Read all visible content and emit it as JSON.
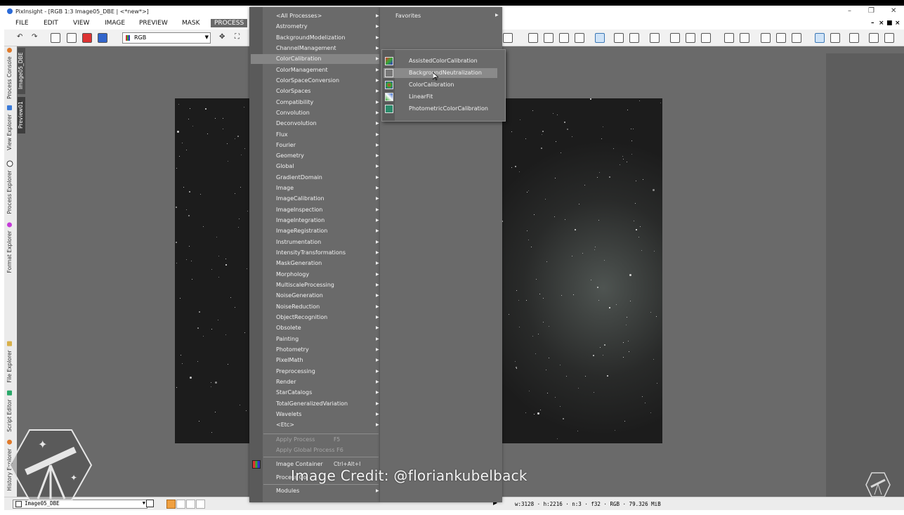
{
  "window": {
    "title": "PixInsight - [RGB 1:3 Image05_DBE | <*new*>]",
    "min": "–",
    "restore": "❐",
    "close": "✕"
  },
  "menubar": {
    "items": [
      "FILE",
      "EDIT",
      "VIEW",
      "IMAGE",
      "PREVIEW",
      "MASK",
      "PROCESS"
    ],
    "active": "PROCESS",
    "mdi_controls": [
      "–",
      "×",
      "■",
      "×"
    ]
  },
  "toolbar": {
    "channel_combo": "RGB"
  },
  "sidebar": {
    "top_tabs": [
      "Process Console",
      "View Explorer",
      "Process Explorer",
      "Format Explorer"
    ],
    "bottom_tabs": [
      "File Explorer",
      "Script Editor",
      "History Explorer"
    ],
    "view_tabs": [
      "Image05_DBE",
      "Preview01"
    ]
  },
  "process_menu": {
    "items": [
      "<All Processes>",
      "Astrometry",
      "BackgroundModelization",
      "ChannelManagement",
      "ColorCalibration",
      "ColorManagement",
      "ColorSpaceConversion",
      "ColorSpaces",
      "Compatibility",
      "Convolution",
      "Deconvolution",
      "Flux",
      "Fourier",
      "Geometry",
      "Global",
      "GradientDomain",
      "Image",
      "ImageCalibration",
      "ImageInspection",
      "ImageIntegration",
      "ImageRegistration",
      "Instrumentation",
      "IntensityTransformations",
      "MaskGeneration",
      "Morphology",
      "MultiscaleProcessing",
      "NoiseGeneration",
      "NoiseReduction",
      "ObjectRecognition",
      "Obsolete",
      "Painting",
      "Photometry",
      "PixelMath",
      "Preprocessing",
      "Render",
      "StarCatalogs",
      "TotalGeneralizedVariation",
      "Wavelets",
      "<Etc>"
    ],
    "selected": "ColorCalibration",
    "apply_process": {
      "label": "Apply Process",
      "shortcut": "F5"
    },
    "apply_global": {
      "label": "Apply Global Process",
      "shortcut": "F6"
    },
    "image_container": {
      "label": "Image Container",
      "shortcut": "Ctrl+Alt+I"
    },
    "process_container": {
      "label": "Process Co"
    },
    "modules": {
      "label": "Modules"
    }
  },
  "favorites_menu": {
    "label": "Favorites"
  },
  "colorcalibration_menu": {
    "items": [
      "AssistedColorCalibration",
      "BackgroundNeutralization",
      "ColorCalibration",
      "LinearFit",
      "PhotometricColorCalibration"
    ],
    "hovered": "BackgroundNeutralization"
  },
  "statusbar": {
    "view_combo": "Image05_DBE",
    "info": "w:3128 · h:2216 · n:3 · f32 · RGB · 79.326 MiB"
  },
  "overlay": {
    "credit": "Image Credit: @floriankubelback"
  },
  "colors": {
    "menu_bg": "#6a6a6a",
    "workspace": "#6a6a6a",
    "highlight": "#858585",
    "active_menu": "#6a6a6a"
  }
}
